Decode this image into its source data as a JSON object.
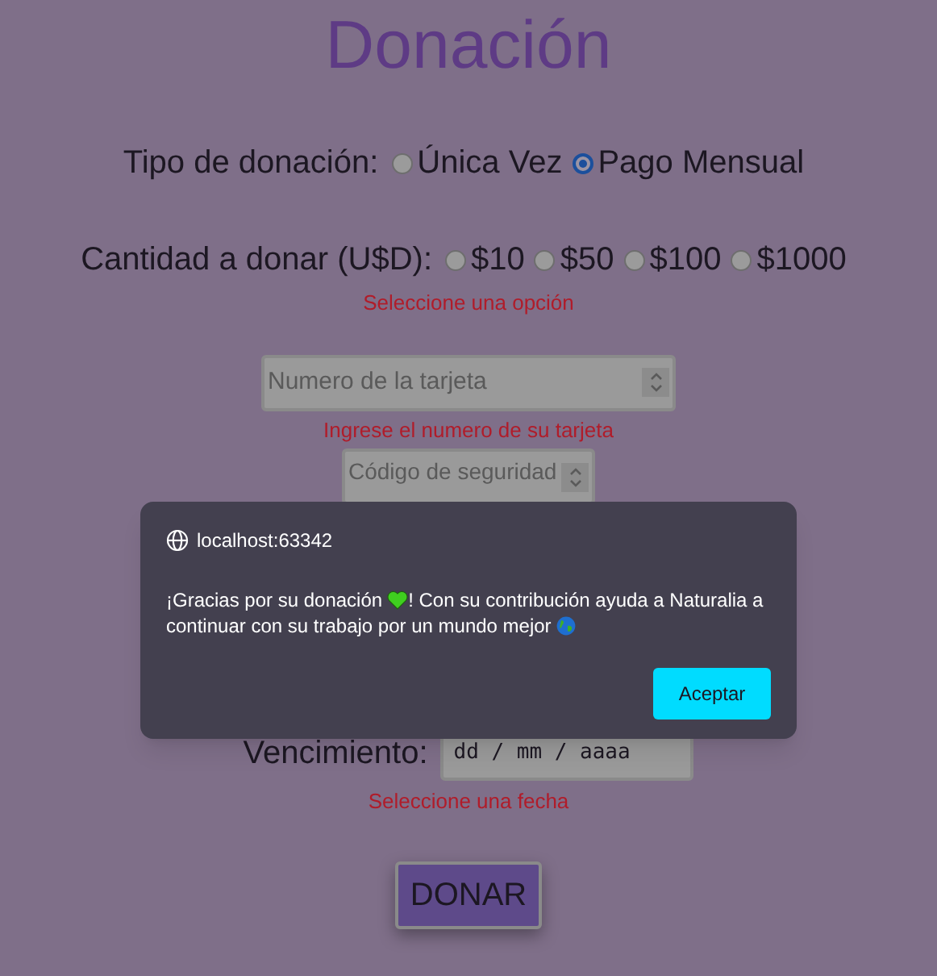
{
  "title": "Donación",
  "donation_type": {
    "label": "Tipo de donación:",
    "options": [
      {
        "label": "Única Vez",
        "selected": false
      },
      {
        "label": "Pago Mensual",
        "selected": true
      }
    ]
  },
  "amount": {
    "label": "Cantidad a donar (U$D):",
    "options": [
      {
        "label": "$10",
        "selected": false
      },
      {
        "label": "$50",
        "selected": false
      },
      {
        "label": "$100",
        "selected": false
      },
      {
        "label": "$1000",
        "selected": false
      }
    ],
    "error": "Seleccione una opción"
  },
  "card_number": {
    "placeholder": "Numero de la tarjeta",
    "error": "Ingrese el numero de su tarjeta"
  },
  "security_code": {
    "placeholder": "Código de seguridad"
  },
  "expiry": {
    "label": "Vencimiento:",
    "placeholder": "dd / mm / aaaa",
    "error": "Seleccione una fecha"
  },
  "submit": "DONAR",
  "dialog": {
    "origin": "localhost:63342",
    "message_start": "¡Gracias por su donación",
    "message_rest": "! Con su contribución ayuda a Naturalia a",
    "message_line2": "continuar con su trabajo por un mundo mejor",
    "button": "Aceptar"
  }
}
